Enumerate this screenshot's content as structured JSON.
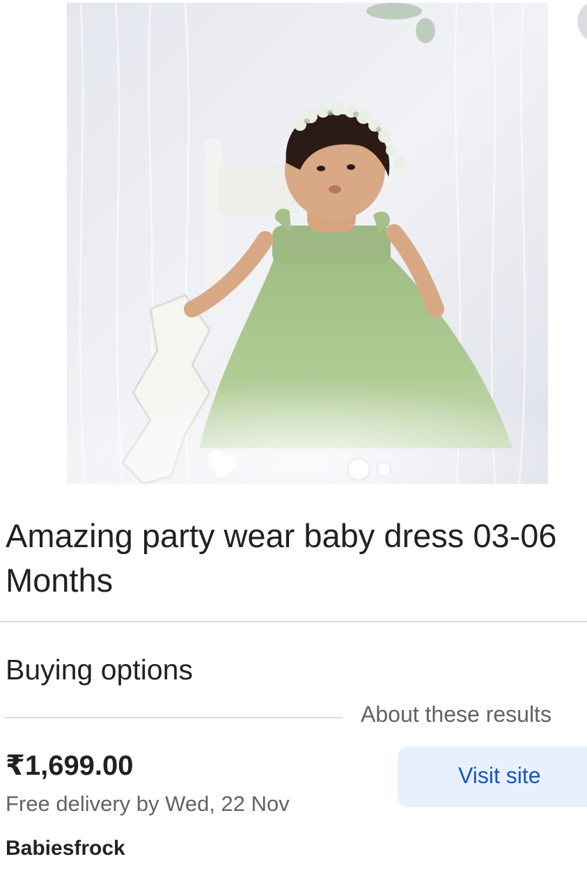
{
  "product": {
    "image_alt": "Baby girl in green tulle party dress with floral crown sitting on white chair",
    "carousel_total": 2,
    "carousel_active": 1,
    "title_line1": "Amazing party wear baby dress 03-06",
    "title_line2": "Months"
  },
  "buying_options": {
    "heading": "Buying options",
    "about_link": "About these results"
  },
  "offer": {
    "price": "₹1,699.00",
    "delivery": "Free delivery by Wed, 22 Nov",
    "seller": "Babiesfrock",
    "visit_label": "Visit site"
  },
  "colors": {
    "accent_text": "#1a56b8",
    "button_bg": "#e8f0fe",
    "dress_green": "#a9c58d"
  }
}
